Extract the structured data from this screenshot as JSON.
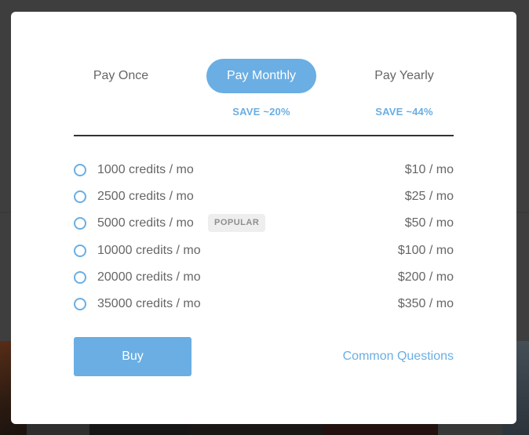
{
  "tabs": [
    {
      "label": "Pay Once",
      "save": ""
    },
    {
      "label": "Pay Monthly",
      "save": "SAVE ~20%"
    },
    {
      "label": "Pay Yearly",
      "save": "SAVE ~44%"
    }
  ],
  "selected_tab": "Pay Monthly",
  "plans": [
    {
      "label": "1000 credits / mo",
      "price": "$10 / mo",
      "badge": ""
    },
    {
      "label": "2500 credits / mo",
      "price": "$25 / mo",
      "badge": ""
    },
    {
      "label": "5000 credits / mo",
      "price": "$50 / mo",
      "badge": "POPULAR"
    },
    {
      "label": "10000 credits / mo",
      "price": "$100 / mo",
      "badge": ""
    },
    {
      "label": "20000 credits / mo",
      "price": "$200 / mo",
      "badge": ""
    },
    {
      "label": "35000 credits / mo",
      "price": "$350 / mo",
      "badge": ""
    }
  ],
  "actions": {
    "buy_label": "Buy",
    "questions_label": "Common Questions"
  },
  "colors": {
    "accent": "#6aaee3",
    "text": "#666666",
    "badge_bg": "#eeeeee",
    "divider": "#333333"
  },
  "icons": {
    "radio": "radio-unselected-icon"
  }
}
